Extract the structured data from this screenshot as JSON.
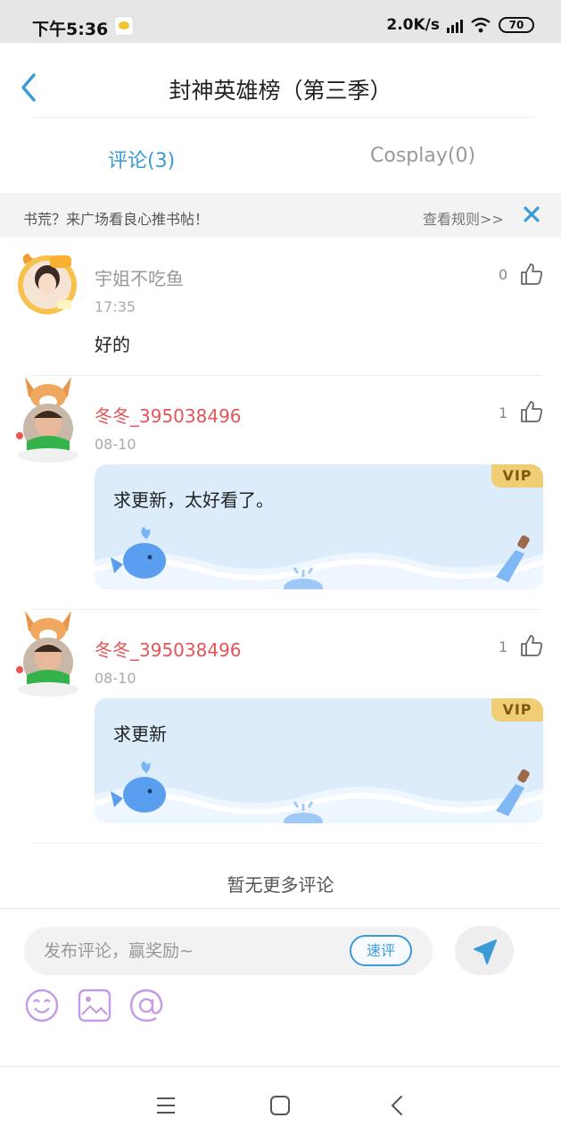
{
  "status_bar": {
    "time": "下午5:36",
    "speed": "2.0K/s",
    "battery": "70"
  },
  "header": {
    "title": "封神英雄榜（第三季）"
  },
  "tabs": [
    {
      "label": "评论(3)",
      "active": true
    },
    {
      "label": "Cosplay(0)",
      "active": false
    }
  ],
  "notice": {
    "text": "书荒？来广场看良心推书帖！",
    "link": "查看规则>>"
  },
  "comments": [
    {
      "username": "宇姐不吃鱼",
      "time": "17:35",
      "likes": "0",
      "text": "好的",
      "vip": false,
      "username_color": "#999999"
    },
    {
      "username": "冬冬_395038496",
      "time": "08-10",
      "likes": "1",
      "text": "求更新，太好看了。",
      "vip": true,
      "username_color": "#e2555a"
    },
    {
      "username": "冬冬_395038496",
      "time": "08-10",
      "likes": "1",
      "text": "求更新",
      "vip": true,
      "username_color": "#e2555a"
    }
  ],
  "vip_badge": "VIP",
  "footer_text": "暂无更多评论",
  "composer": {
    "placeholder": "发布评论，赢奖励~",
    "quick_review": "速评",
    "tools": [
      "emoji-icon",
      "image-icon",
      "mention-icon"
    ]
  },
  "colors": {
    "accent": "#3a9bd6",
    "vip_username": "#e2555a",
    "vip_card": "#dcecfb",
    "vip_badge": "#f0cf74",
    "tool_icons": "#c39be6"
  }
}
